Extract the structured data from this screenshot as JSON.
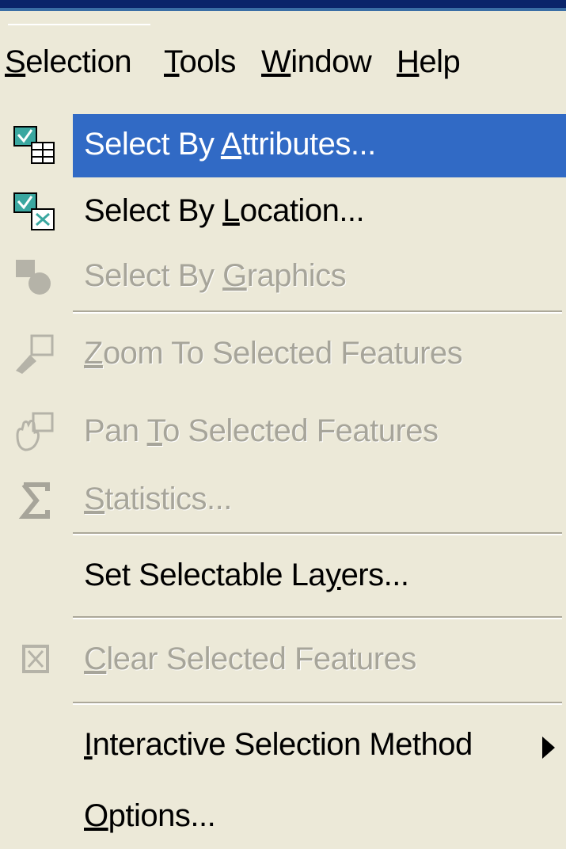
{
  "menubar": {
    "items": [
      {
        "pre": "",
        "u": "S",
        "post": "election"
      },
      {
        "pre": "",
        "u": "T",
        "post": "ools"
      },
      {
        "pre": "",
        "u": "W",
        "post": "indow"
      },
      {
        "pre": "",
        "u": "H",
        "post": "elp"
      }
    ]
  },
  "menu": {
    "items": [
      {
        "pre": "Select By ",
        "u": "A",
        "post": "ttributes...",
        "icon": "select-by-attributes-icon",
        "state": "highlighted"
      },
      {
        "pre": "Select By ",
        "u": "L",
        "post": "ocation...",
        "icon": "select-by-location-icon",
        "state": "enabled"
      },
      {
        "pre": "Select By ",
        "u": "G",
        "post": "raphics",
        "icon": "select-by-graphics-icon",
        "state": "disabled"
      },
      {
        "pre": "",
        "u": "Z",
        "post": "oom To Selected Features",
        "icon": "zoom-to-selected-icon",
        "state": "disabled"
      },
      {
        "pre": "Pan ",
        "u": "T",
        "post": "o Selected Features",
        "icon": "pan-to-selected-icon",
        "state": "disabled"
      },
      {
        "pre": "",
        "u": "S",
        "post": "tatistics...",
        "icon": "sigma-icon",
        "state": "disabled"
      },
      {
        "pre": "Set Selectable La",
        "u": "y",
        "post": "ers...",
        "icon": "",
        "state": "enabled"
      },
      {
        "pre": "",
        "u": "C",
        "post": "lear Selected Features",
        "icon": "clear-selected-icon",
        "state": "disabled"
      },
      {
        "pre": "",
        "u": "I",
        "post": "nteractive Selection Method",
        "icon": "submenu-arrow-icon",
        "state": "enabled"
      },
      {
        "pre": "",
        "u": "O",
        "post": "ptions...",
        "icon": "",
        "state": "enabled"
      }
    ]
  },
  "colors": {
    "highlight": "#316ac5",
    "menu_bg": "#ece9d8",
    "disabled_text": "#a7a59a"
  }
}
